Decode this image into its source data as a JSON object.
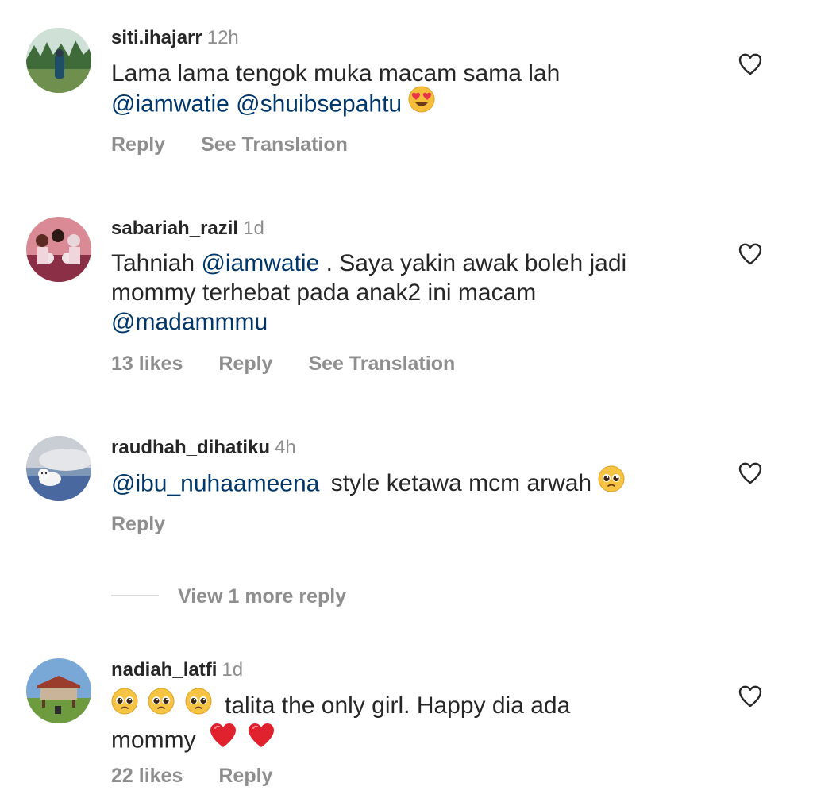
{
  "comments": [
    {
      "username": "siti.ihajarr",
      "time": "12h",
      "line1": "Lama lama tengok muka macam sama lah",
      "line2_mention1": "@iamwatie",
      "line2_mention2": "@shuibsepahtu",
      "emoji": "heart-eyes",
      "reply": "Reply",
      "translate": "See Translation"
    },
    {
      "username": "sabariah_razil",
      "time": "1d",
      "line1_prefix": "Tahniah",
      "line1_mention": "@iamwatie",
      "line1_suffix": ". Saya yakin awak boleh jadi",
      "line2": "mommy terhebat pada anak2 ini macam",
      "line3_mention": "@madammmu",
      "likes": "13 likes",
      "reply": "Reply",
      "translate": "See Translation"
    },
    {
      "username": "raudhah_dihatiku",
      "time": "4h",
      "mention": "@ibu_nuhaameena",
      "text": "style ketawa mcm arwah",
      "emoji": "pleading-face",
      "reply": "Reply"
    },
    {
      "username": "nadiah_latfi",
      "time": "1d",
      "line1": "talita the only girl. Happy dia ada",
      "line2": "mommy",
      "emojis_line1": [
        "pleading-face",
        "pleading-face",
        "pleading-face"
      ],
      "emojis_line2": [
        "red-heart",
        "red-heart"
      ],
      "likes": "22 likes",
      "reply": "Reply"
    }
  ],
  "view_more": "View 1 more reply",
  "colors": {
    "text": "#262626",
    "mention": "#00376b",
    "muted": "#8e8e8e"
  }
}
